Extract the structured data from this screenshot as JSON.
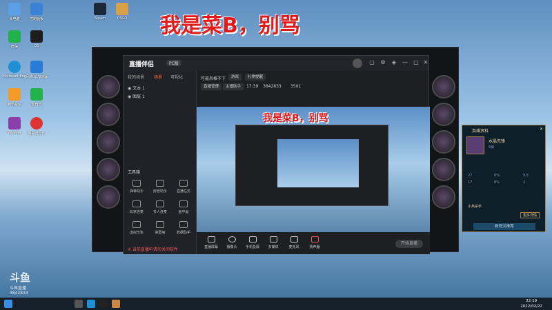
{
  "overlay_banner": "我是菜B，别骂",
  "desktop_icons": [
    {
      "label": "此电脑",
      "color": "#5a9fe8"
    },
    {
      "label": "控制面板",
      "color": "#3b82d6"
    },
    {
      "label": "微信",
      "color": "#22b14c"
    },
    {
      "label": "QQ",
      "color": "#1d1d1d"
    },
    {
      "label": "Microsoft Edge",
      "color": "#1f8fd6"
    },
    {
      "label": "网易UU加速器",
      "color": "#2a7ad8"
    },
    {
      "label": "腾讯视频",
      "color": "#f29a2a"
    },
    {
      "label": "爱奇艺",
      "color": "#22b14c"
    },
    {
      "label": "WinRAR",
      "color": "#8b3fa8"
    },
    {
      "label": "网易云音乐",
      "color": "#d33"
    },
    {
      "label": "Steam",
      "color": "#1b2838"
    },
    {
      "label": "CSGO",
      "color": "#d9a04a"
    }
  ],
  "app": {
    "name": "直播伴侣",
    "tag": "PC版",
    "left_tabs": [
      "我的场景",
      "场景",
      "可视化"
    ],
    "scenes": [
      "文本 1",
      "图层 1"
    ],
    "tools_header": "工具箱",
    "tools": [
      "弹幕助手",
      "房管助手",
      "直播任务",
      "玩家连麦",
      "多人连麦",
      "画中画",
      "虚拟形象",
      "弹幕墙",
      "数据助手"
    ],
    "notice": "※ 当前直播中请勿关闭软件",
    "stream_title": "可能风格不下",
    "category": "游戏",
    "tags_label": "礼物提醒",
    "info_chips": [
      "直播管理",
      "主播助手",
      "17:39",
      "3842833",
      "3501"
    ],
    "bottom_buttons": [
      "直播屏幕",
      "摄像头",
      "手机投屏",
      "多媒体",
      "麦克风",
      "扬声器"
    ],
    "start_label": "开始直播"
  },
  "hero_panel": {
    "title": "英雄资料",
    "hero_name": "水晶先锋",
    "level": "5级",
    "stats": [
      "27",
      "17",
      "0%",
      "0%",
      "9.5",
      "2"
    ],
    "item_name": "小兵杀手",
    "button": "更多详情",
    "apply_button": "新符文推荐"
  },
  "watermark": {
    "brand": "斗鱼",
    "sub": "斗鱼直播",
    "room": "3842833"
  },
  "clock": {
    "time": "22:19",
    "date": "2022/02/22"
  }
}
